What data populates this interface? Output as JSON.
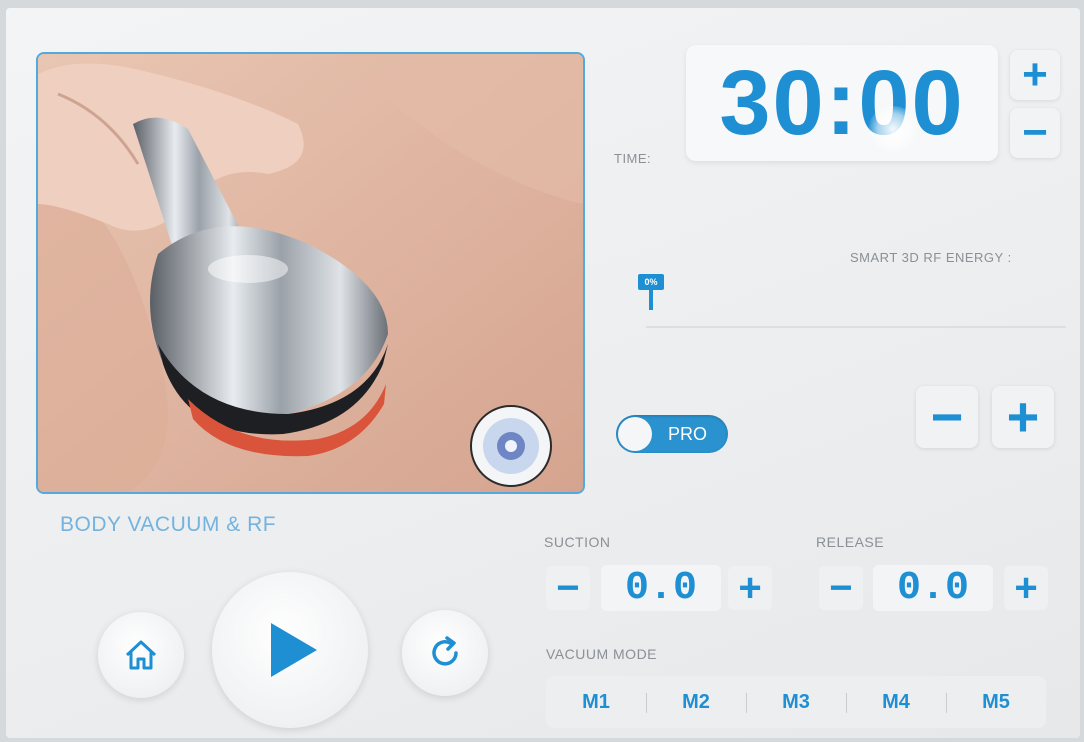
{
  "product": {
    "title": "BODY VACUUM & RF"
  },
  "timer": {
    "label": "TIME:",
    "value": "30:00",
    "plus": "+",
    "minus": "−"
  },
  "energy": {
    "label": "SMART 3D RF ENERGY :",
    "percent_label": "0%",
    "level": 0,
    "minus": "−",
    "plus": "+"
  },
  "pro_toggle": {
    "label": "PRO",
    "state": "on"
  },
  "suction": {
    "label": "SUCTION",
    "value": "0.0",
    "minus": "−",
    "plus": "+"
  },
  "release": {
    "label": "RELEASE",
    "value": "0.0",
    "minus": "−",
    "plus": "+"
  },
  "vacuum_mode": {
    "label": "VACUUM MODE",
    "modes": [
      "M1",
      "M2",
      "M3",
      "M4",
      "M5"
    ]
  },
  "controls": {
    "home_icon": "home-icon",
    "play_icon": "play-icon",
    "reset_icon": "refresh-icon"
  },
  "colors": {
    "accent": "#1e8fd3",
    "title": "#73b3de",
    "frame": "#54a9dc"
  }
}
